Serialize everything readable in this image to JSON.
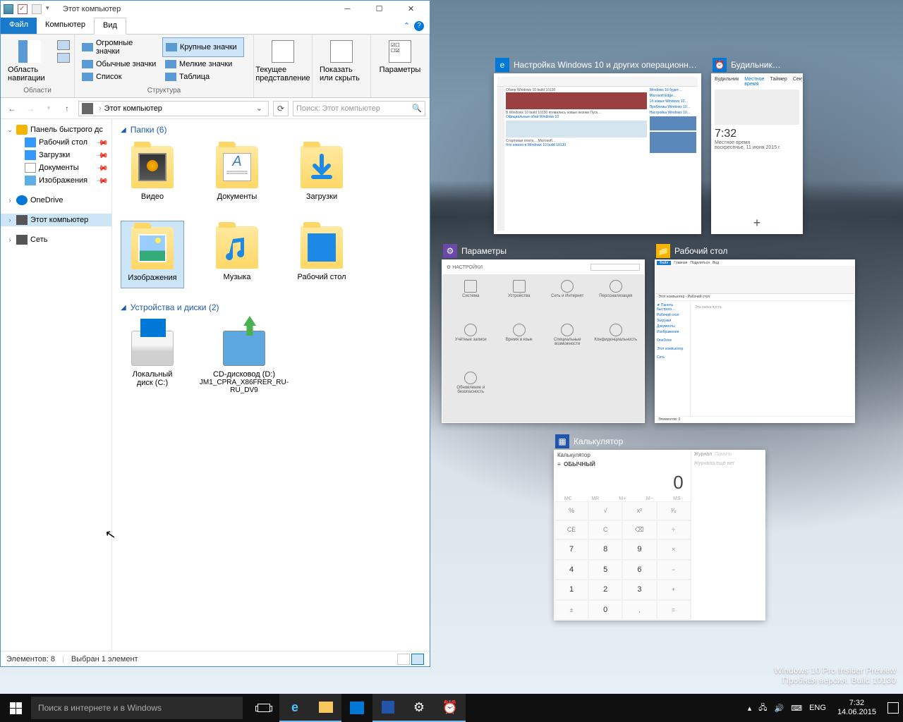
{
  "explorer": {
    "title": "Этот компьютер",
    "tabs": {
      "file": "Файл",
      "computer": "Компьютер",
      "view": "Вид"
    },
    "ribbon": {
      "nav_pane": "Область навигации",
      "nav_group": "Области",
      "layout": {
        "xl": "Огромные значки",
        "l": "Крупные значки",
        "m": "Обычные значки",
        "s": "Мелкие значки",
        "list": "Список",
        "table": "Таблица"
      },
      "layout_group": "Структура",
      "current_view": "Текущее представление",
      "show_hide": "Показать или скрыть",
      "options": "Параметры"
    },
    "address": {
      "crumb": "Этот компьютер",
      "search_placeholder": "Поиск: Этот компьютер"
    },
    "sidebar": {
      "quick": "Панель быстрого дс",
      "desktop": "Рабочий стол",
      "downloads": "Загрузки",
      "documents": "Документы",
      "pictures": "Изображения",
      "onedrive": "OneDrive",
      "this_pc": "Этот компьютер",
      "network": "Сеть"
    },
    "groups": {
      "folders": "Папки (6)",
      "devices": "Устройства и диски (2)"
    },
    "folders": {
      "video": "Видео",
      "documents": "Документы",
      "downloads": "Загрузки",
      "pictures": "Изображения",
      "music": "Музыка",
      "desktop": "Рабочий стол"
    },
    "drives": {
      "local": "Локальный диск (C:)",
      "cd": "CD-дисковод (D:)",
      "cd_label": "JM1_CPRA_X86FRER_RU-RU_DV9"
    },
    "status": {
      "items": "Элементов: 8",
      "selected": "Выбран 1 элемент"
    }
  },
  "taskview": {
    "edge": "Настройка Windows 10 и других операционн…",
    "alarm": "Будильник…",
    "alarm_time": "7:32",
    "alarm_tz": "Местное время",
    "alarm_date": "воскресенье, 11 июня 2015 г.",
    "alarm_tabs": {
      "a": "Будильник",
      "b": "Местное время",
      "c": "Таймер",
      "d": "Секундомер"
    },
    "settings": "Параметры",
    "settings_header": "НАСТРОЙКИ",
    "settings_items": {
      "system": "Система",
      "devices": "Устройства",
      "network": "Сеть и Интернет",
      "personalization": "Персонализация",
      "accounts": "Учётные записи",
      "time": "Время и язык",
      "ease": "Специальные возможности",
      "privacy": "Конфиденциальность",
      "update": "Обновление и безопасность"
    },
    "desktop_explorer": "Рабочий стол",
    "calculator": "Калькулятор",
    "calc": {
      "title": "Калькулятор",
      "mode": "ОБЫЧНЫЙ",
      "display": "0",
      "history": "Журнал",
      "memory": "Память",
      "history_empty": "Журнала ещё нет"
    }
  },
  "watermark": {
    "line1": "Windows 10 Pro Insider Preview",
    "line2": "Пробная версия. Build 10130"
  },
  "taskbar": {
    "search": "Поиск в интернете и в Windows",
    "lang": "ENG",
    "time": "7:32",
    "date": "14.06.2015"
  }
}
